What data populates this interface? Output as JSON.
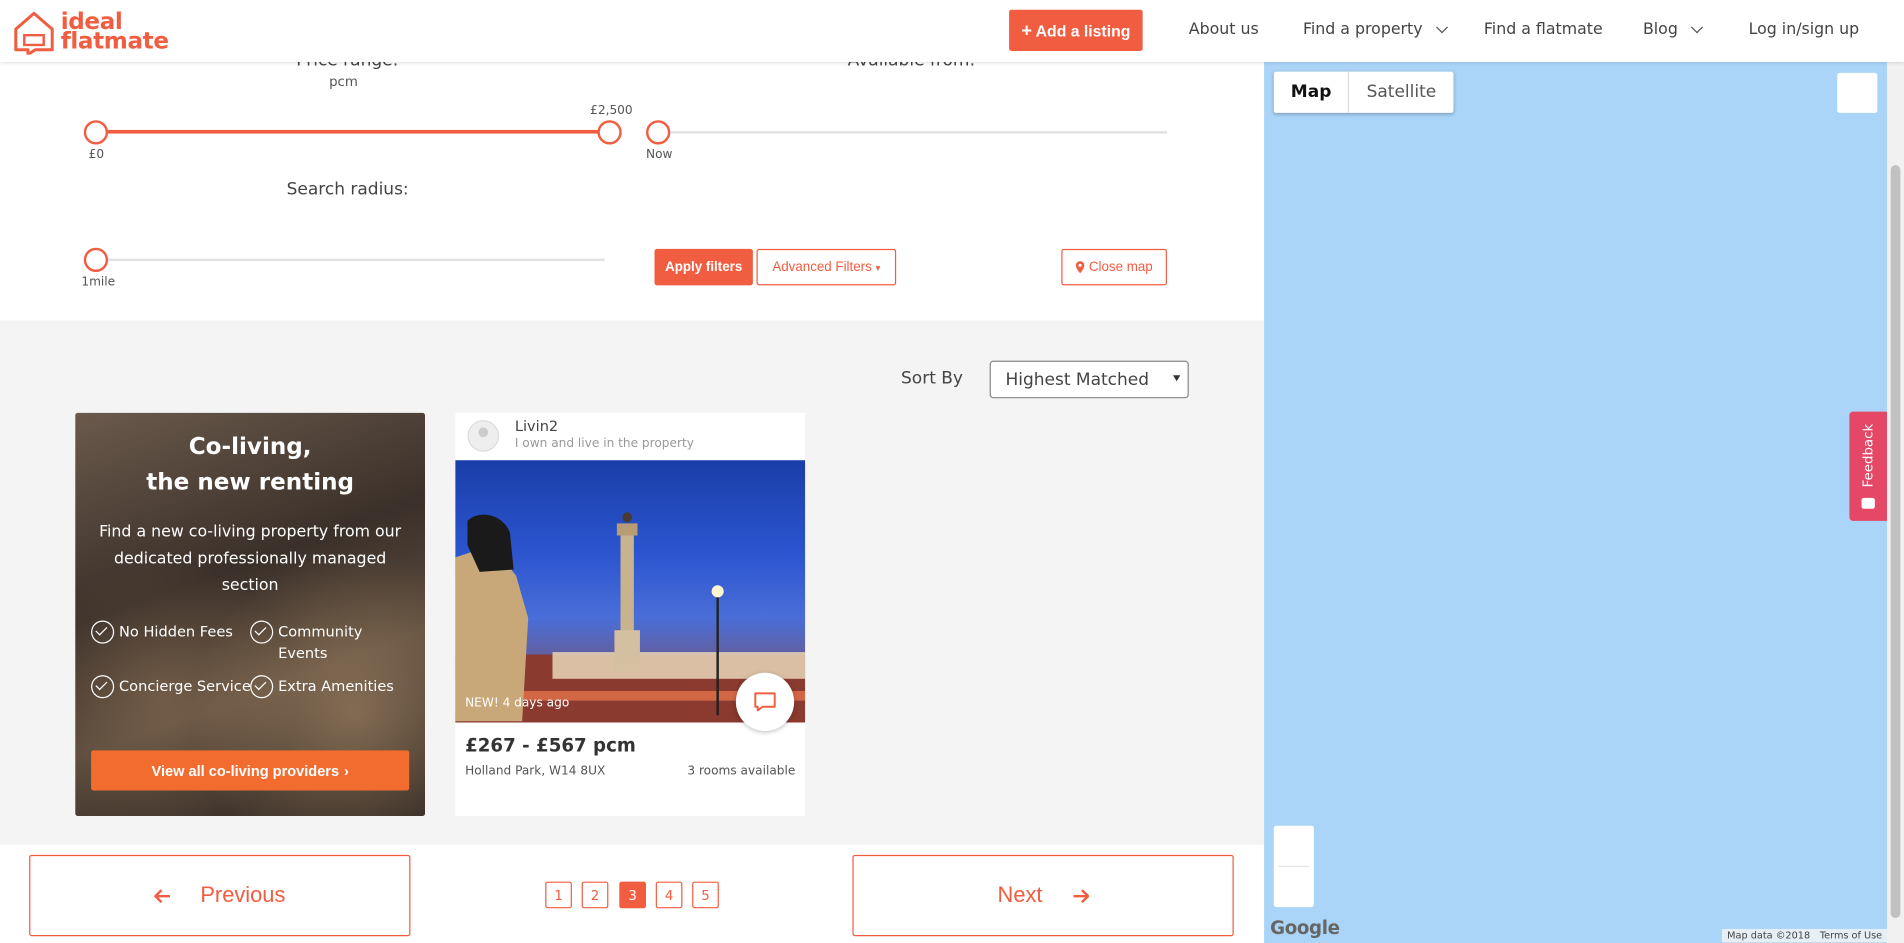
{
  "header": {
    "logo_line1": "ideal",
    "logo_line2": "flatmate",
    "add_listing": "Add a listing",
    "nav": {
      "about": "About us",
      "find_property": "Find a property",
      "find_flatmate": "Find a flatmate",
      "blog": "Blog",
      "login": "Log in/sign up"
    }
  },
  "filters": {
    "price_label": "Price range:",
    "price_unit": "pcm",
    "price_min": "£0",
    "price_max": "£2,500",
    "available_label": "Available from:",
    "available_value": "Now",
    "radius_label": "Search radius:",
    "radius_value": "1mile",
    "apply": "Apply filters",
    "advanced": "Advanced Filters",
    "close_map": "Close map"
  },
  "sort": {
    "label": "Sort By",
    "selected": "Highest Matched"
  },
  "promo": {
    "title_line1": "Co-living,",
    "title_line2": "the new renting",
    "body": "Find a new co-living property from our dedicated professionally managed section",
    "features": [
      "No Hidden Fees",
      "Community Events",
      "Concierge Service",
      "Extra Amenities"
    ],
    "cta": "View all co-living providers"
  },
  "listing": {
    "owner": "Livin2",
    "owner_sub": "I own and live in the property",
    "badge": "NEW! 4 days ago",
    "price": "£267 - £567 pcm",
    "address": "Holland Park, W14 8UX",
    "rooms": "3 rooms available"
  },
  "pagination": {
    "previous": "Previous",
    "next": "Next",
    "pages": [
      "1",
      "2",
      "3",
      "4",
      "5"
    ],
    "current": "3"
  },
  "map": {
    "map_tab": "Map",
    "satellite_tab": "Satellite",
    "google": "Google",
    "map_data": "Map data ©2018",
    "terms": "Terms of Use"
  },
  "feedback": "Feedback",
  "colors": {
    "brand": "#f15d41",
    "cta_orange": "#f26b2f",
    "map_water": "#abd5f8",
    "feedback": "#e54767"
  }
}
